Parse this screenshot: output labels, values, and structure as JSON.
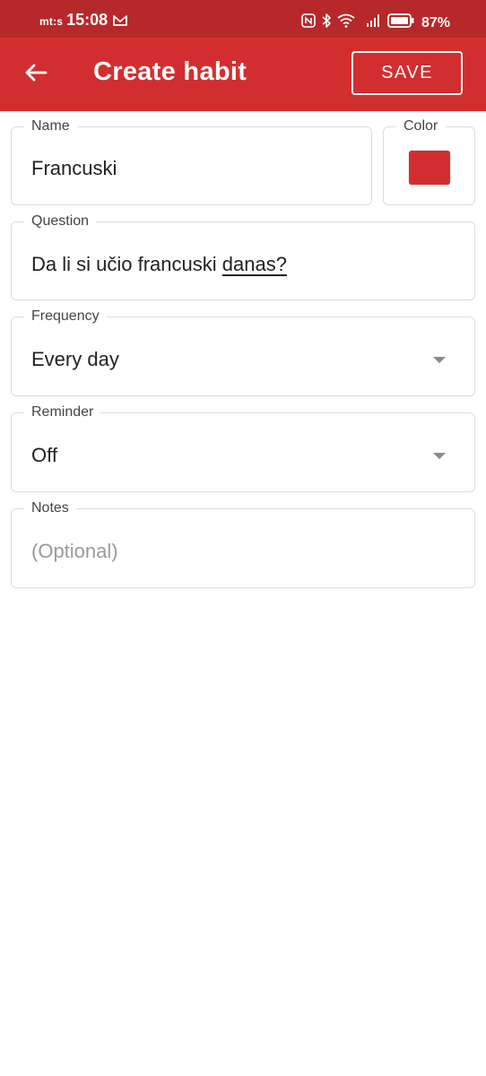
{
  "status_bar": {
    "carrier": "mt:s",
    "time": "15:08",
    "battery_percent": "87%",
    "icons": [
      "mail-icon",
      "nfc-icon",
      "bluetooth-icon",
      "wifi-icon",
      "signal-icon",
      "battery-icon"
    ]
  },
  "app_bar": {
    "title": "Create habit",
    "save_label": "SAVE",
    "back_icon": "arrow-left-icon",
    "color": "#d32e2f"
  },
  "form": {
    "name": {
      "label": "Name",
      "value": "Francuski"
    },
    "color": {
      "label": "Color",
      "value": "#d32e2f"
    },
    "question": {
      "label": "Question",
      "value_prefix": "Da li si učio francuski ",
      "value_underlined": "danas?"
    },
    "frequency": {
      "label": "Frequency",
      "value": "Every day"
    },
    "reminder": {
      "label": "Reminder",
      "value": "Off"
    },
    "notes": {
      "label": "Notes",
      "placeholder": "(Optional)"
    }
  }
}
